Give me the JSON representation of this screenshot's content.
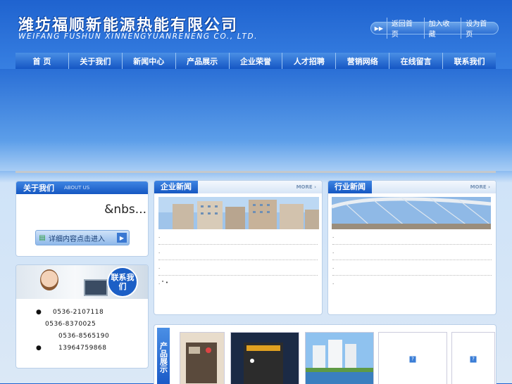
{
  "header": {
    "company_cn": "潍坊福顺新能源热能有限公司",
    "company_en": "WEIFANG FUSHUN XINNENGYUANRENENG CO., LTD.",
    "toplinks": [
      "返回首页",
      "加入收藏",
      "设为首页"
    ]
  },
  "nav": [
    "首 页",
    "关于我们",
    "新闻中心",
    "产品展示",
    "企业荣誉",
    "人才招聘",
    "营销网络",
    "在线留言",
    "联系我们"
  ],
  "about": {
    "title": "关于我们",
    "subtitle": "ABOUT US",
    "text": "&nbs...",
    "button": "详细内容点击进入"
  },
  "contact": {
    "seal": "联系我们",
    "phones": [
      "0536-2107118",
      "0536-8370025",
      "0536-8565190",
      "13964759868"
    ]
  },
  "company_news": {
    "title": "企业新闻",
    "more": "MORE",
    "rows": [
      ".",
      ".",
      ".",
      ". \" •"
    ]
  },
  "industry_news": {
    "title": "行业新闻",
    "more": "MORE",
    "rows": [
      ".",
      ".",
      ".",
      "."
    ]
  },
  "products": {
    "side_title": "产品展示",
    "missing_icon": "?"
  },
  "colors": {
    "nav": "#1556c4",
    "accent": "#3f85e3"
  }
}
